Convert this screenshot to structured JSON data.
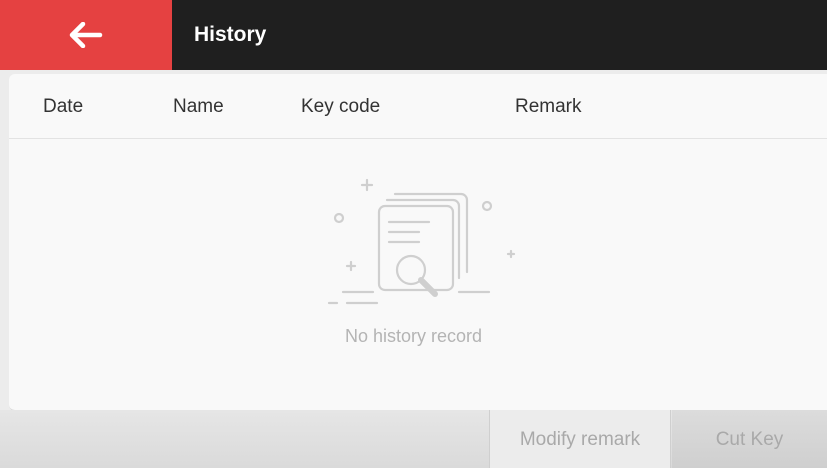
{
  "header": {
    "back_icon": "arrow-left-icon",
    "title": "History",
    "accent_color": "#e54141"
  },
  "table": {
    "columns": [
      "Date",
      "Name",
      "Key code",
      "Remark"
    ],
    "rows": []
  },
  "empty_state": {
    "icon": "document-search-icon",
    "message": "No history record"
  },
  "footer": {
    "modify_remark_label": "Modify remark",
    "cut_key_label": "Cut Key"
  }
}
